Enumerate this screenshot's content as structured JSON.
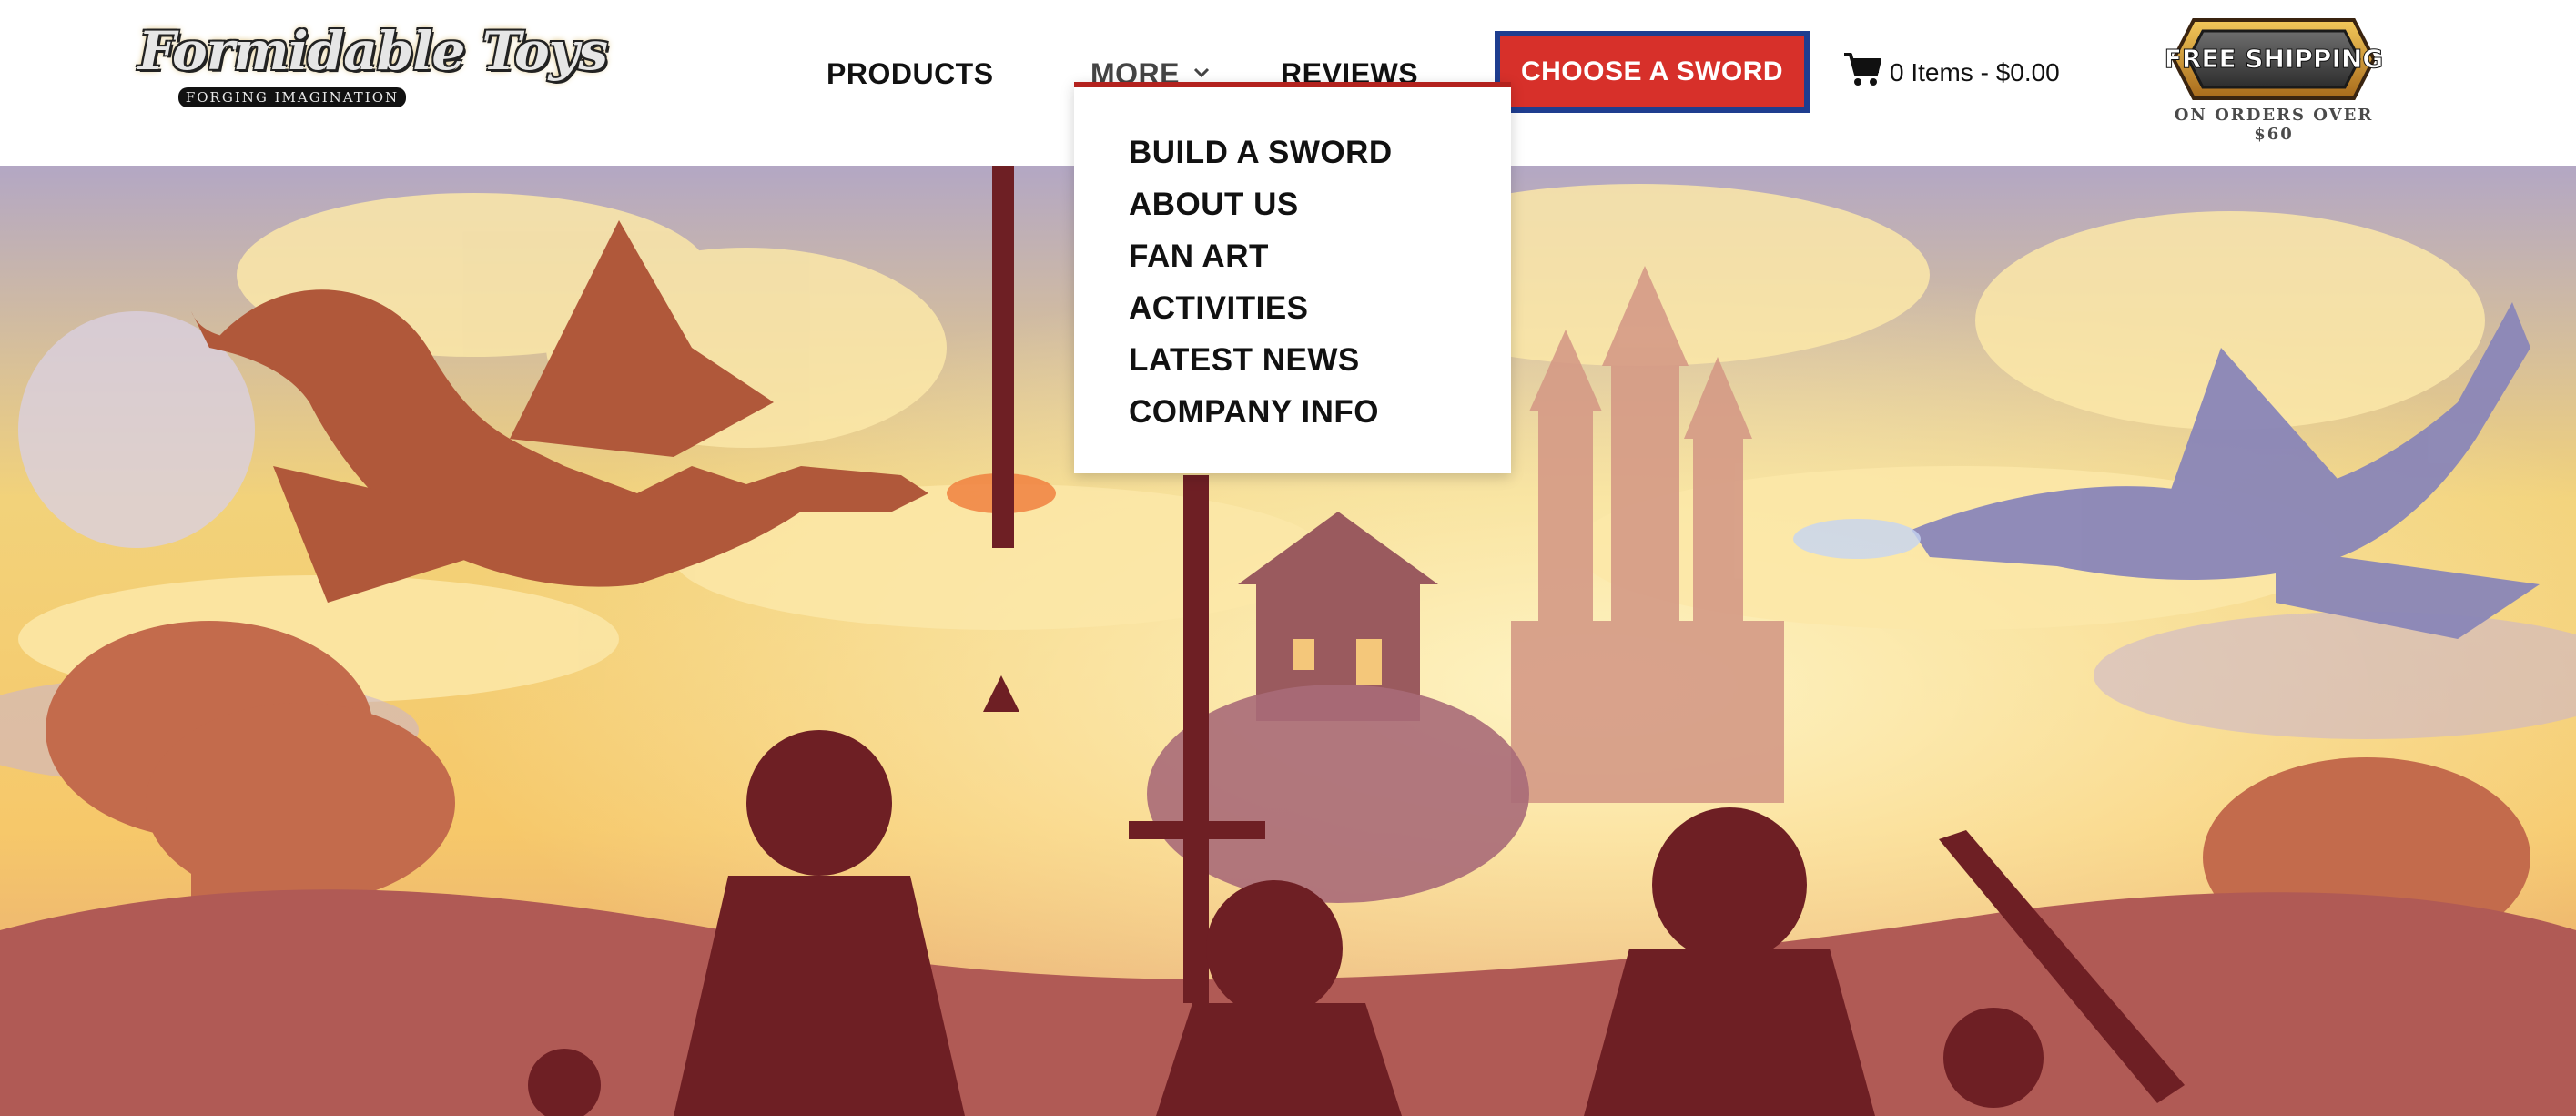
{
  "header": {
    "logo": {
      "wordmark": "Formidable Toys",
      "tagline": "FORGING IMAGINATION",
      "icon": "formidable-toys-logo"
    },
    "nav": {
      "products": "PRODUCTS",
      "more": "MORE",
      "more_icon": "chevron-down-icon",
      "reviews": "REVIEWS"
    },
    "cta": "CHOOSE A SWORD",
    "cart": {
      "icon": "cart-icon",
      "summary": "0 Items - $0.00"
    },
    "shipping_badge": {
      "title": "FREE SHIPPING",
      "subtitle": "ON ORDERS OVER $60"
    }
  },
  "more_menu": {
    "items": [
      "BUILD A SWORD",
      "ABOUT US",
      "FAN ART",
      "ACTIVITIES",
      "LATEST NEWS",
      "COMPANY INFO"
    ]
  },
  "hero": {
    "image": "fantasy-illustration-dragons-castle-children-silhouettes"
  },
  "colors": {
    "accent_red": "#d7302a",
    "accent_blue": "#1e3d8f",
    "dropdown_bar": "#b3221e",
    "text": "#111111"
  }
}
